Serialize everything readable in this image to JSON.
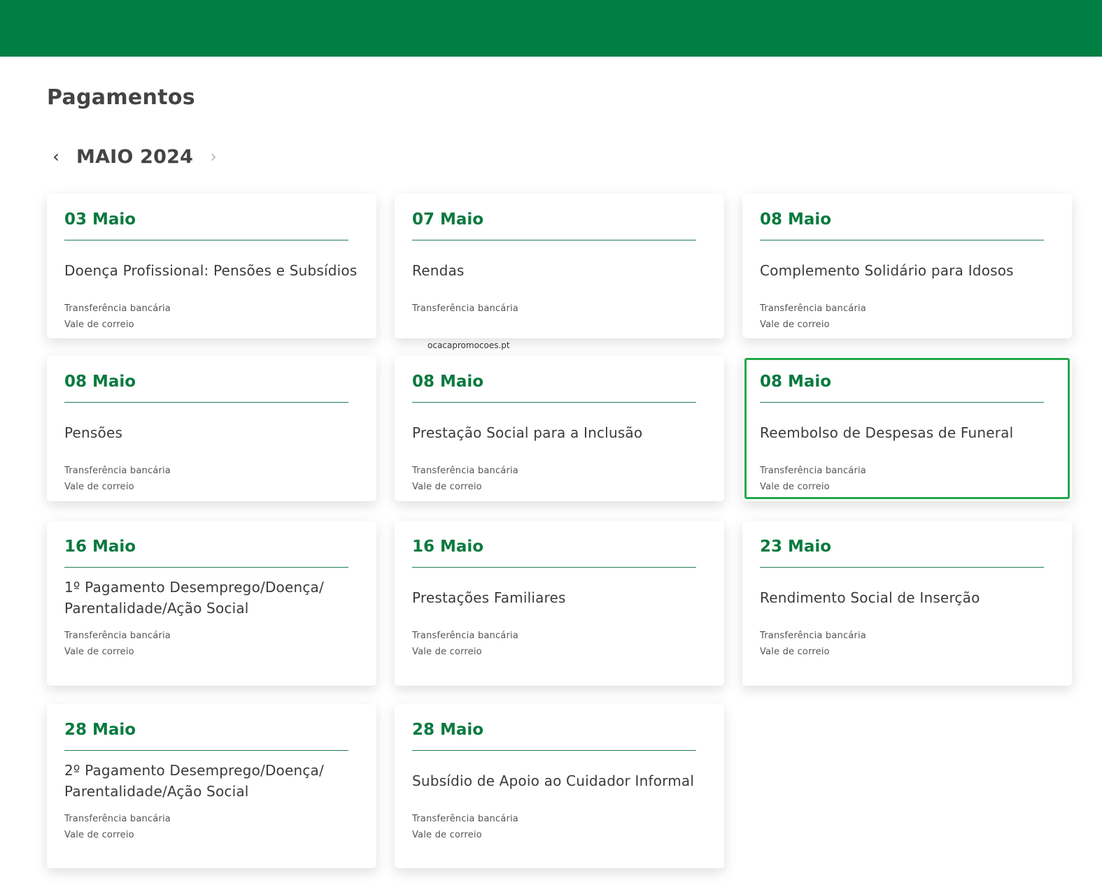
{
  "page": {
    "title": "Pagamentos",
    "month_label": "MAIO 2024",
    "prev_icon": "chevron-left-icon",
    "next_icon": "chevron-right-icon",
    "watermark": "ocacapromocoes.pt"
  },
  "colors": {
    "brand_green": "#007f45",
    "date_green": "#0a7a3f",
    "highlight": "#22a84a"
  },
  "cards": [
    {
      "date": "03 Maio",
      "title": "Doença Profissional: Pensões e Subsídios",
      "methods": [
        "Transferência bancária",
        "Vale de correio"
      ]
    },
    {
      "date": "07 Maio",
      "title": "Rendas",
      "methods": [
        "Transferência bancária"
      ]
    },
    {
      "date": "08 Maio",
      "title": "Complemento Solidário para Idosos",
      "methods": [
        "Transferência bancária",
        "Vale de correio"
      ]
    },
    {
      "date": "08 Maio",
      "title": "Pensões",
      "methods": [
        "Transferência bancária",
        "Vale de correio"
      ]
    },
    {
      "date": "08 Maio",
      "title": "Prestação Social para a Inclusão",
      "methods": [
        "Transferência bancária",
        "Vale de correio"
      ]
    },
    {
      "date": "08 Maio",
      "title": "Reembolso de Despesas de Funeral",
      "methods": [
        "Transferência bancária",
        "Vale de correio"
      ],
      "highlighted": true
    },
    {
      "date": "16 Maio",
      "title": "1º Pagamento Desemprego/Doença/ Parentalidade/Ação Social",
      "methods": [
        "Transferência bancária",
        "Vale de correio"
      ]
    },
    {
      "date": "16 Maio",
      "title": "Prestações Familiares",
      "methods": [
        "Transferência bancária",
        "Vale de correio"
      ]
    },
    {
      "date": "23 Maio",
      "title": "Rendimento Social de Inserção",
      "methods": [
        "Transferência bancária",
        "Vale de correio"
      ]
    },
    {
      "date": "28 Maio",
      "title": "2º Pagamento Desemprego/Doença/ Parentalidade/Ação Social",
      "methods": [
        "Transferência bancária",
        "Vale de correio"
      ]
    },
    {
      "date": "28 Maio",
      "title": "Subsídio de Apoio ao Cuidador Informal",
      "methods": [
        "Transferência bancária",
        "Vale de correio"
      ]
    }
  ]
}
